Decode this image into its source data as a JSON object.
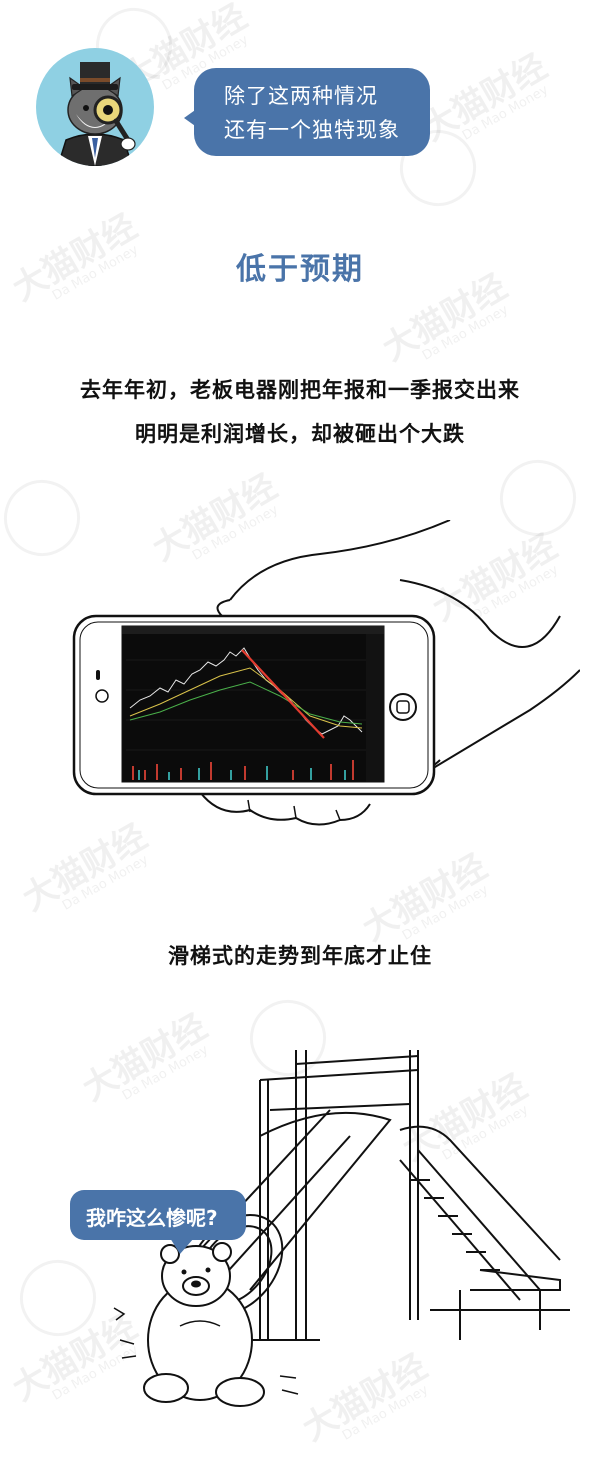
{
  "speech_top": {
    "line1": "除了这两种情况",
    "line2": "还有一个独特现象"
  },
  "section_title": "低于预期",
  "paragraph": {
    "line1": "去年年初，老板电器刚把年报和一季报交出来",
    "line2": "明明是利润增长，却被砸出个大跌"
  },
  "caption_slide": "滑梯式的走势到年底才止住",
  "speech_bear": "我咋这么惨呢?",
  "watermark": {
    "text": "大猫财经",
    "sub": "Da Mao Money"
  },
  "colors": {
    "accent_blue": "#4a74a9",
    "avatar_bg": "#8fd0e3",
    "chart_bg": "#0b0b0b",
    "chart_red": "#e23b2f"
  }
}
